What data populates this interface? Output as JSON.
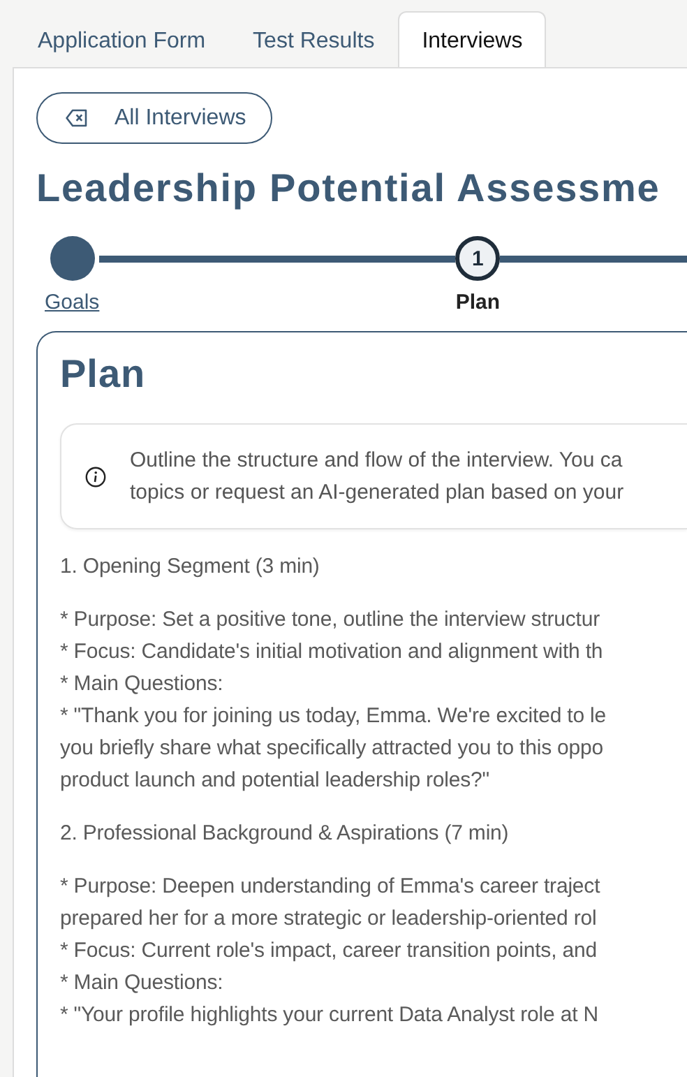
{
  "tabs": [
    {
      "label": "Application Form",
      "selected": false
    },
    {
      "label": "Test Results",
      "selected": false
    },
    {
      "label": "Interviews",
      "selected": true
    }
  ],
  "back_button": {
    "label": "All Interviews"
  },
  "title": "Leadership Potential Assessme",
  "stepper": [
    {
      "label": "Goals",
      "completed": true,
      "current": false
    },
    {
      "label": "Plan",
      "number": "1",
      "completed": false,
      "current": true
    }
  ],
  "card": {
    "title": "Plan",
    "info_lines": [
      "Outline the structure and flow of the interview. You ca",
      "topics or request an AI-generated plan based on your"
    ],
    "paragraphs": [
      [
        "1. Opening Segment (3 min)"
      ],
      [
        "* Purpose: Set a positive tone, outline the interview structur",
        "* Focus: Candidate's initial motivation and alignment with th",
        "* Main Questions:",
        "* \"Thank you for joining us today, Emma. We're excited to le",
        "you briefly share what specifically attracted you to this oppo",
        "product launch and potential leadership roles?\""
      ],
      [
        "2. Professional Background & Aspirations (7 min)"
      ],
      [
        "* Purpose: Deepen understanding of Emma's career traject",
        "prepared her for a more strategic or leadership-oriented rol",
        "* Focus: Current role's impact, career transition points, and",
        "* Main Questions:",
        "* \"Your profile highlights your current Data Analyst role at N"
      ]
    ]
  }
}
